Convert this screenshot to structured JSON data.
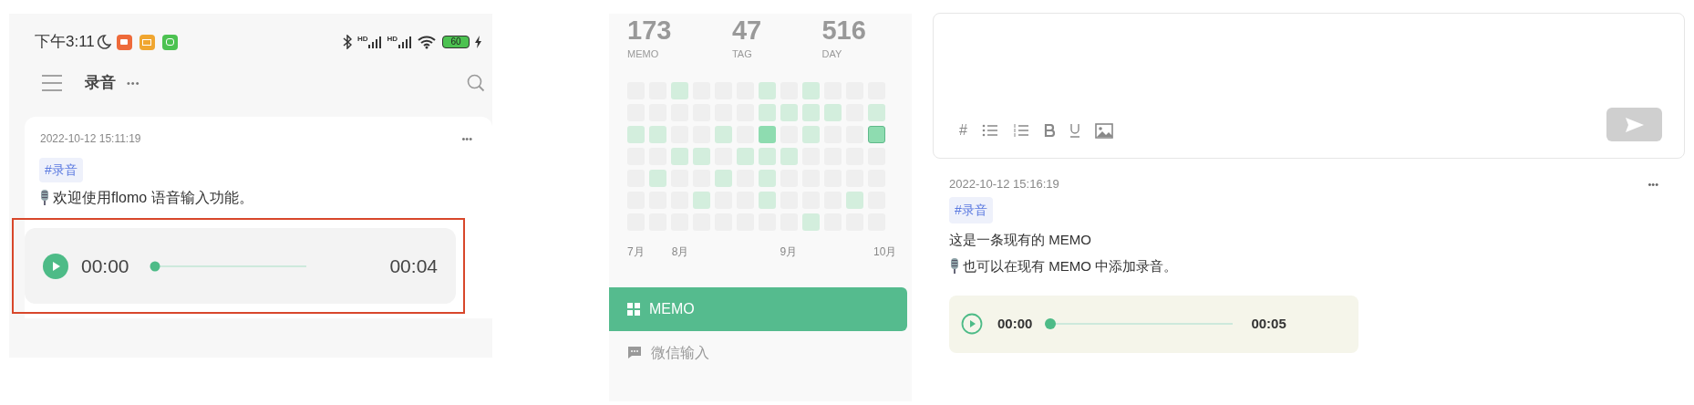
{
  "phone": {
    "status_bar": {
      "time": "下午3:11",
      "signals": [
        {
          "label": "HD"
        },
        {
          "label": "HD"
        }
      ],
      "battery": "60"
    },
    "header": {
      "title": "录音",
      "more": "•••"
    },
    "memo": {
      "date": "2022-10-12 15:11:19",
      "more": "•••",
      "tag": "#录音",
      "body": "欢迎使用flomo 语音输入功能。",
      "player": {
        "current": "00:00",
        "level": 0,
        "duration": "00:04"
      },
      "highlighted": true
    }
  },
  "sidebar": {
    "stats": [
      {
        "value": "173",
        "label": "MEMO"
      },
      {
        "value": "47",
        "label": "TAG"
      },
      {
        "value": "516",
        "label": "DAY"
      }
    ],
    "heatmap": {
      "rows": [
        {
          "cells": [
            {
              "color": "#efefef",
              "today": false
            },
            {
              "color": "#efefef",
              "today": false
            },
            {
              "color": "#d3eedd",
              "today": false
            },
            {
              "color": "#efefef",
              "today": false
            },
            {
              "color": "#efefef",
              "today": false
            },
            {
              "color": "#efefef",
              "today": false
            },
            {
              "color": "#d3eedd",
              "today": false
            },
            {
              "color": "#efefef",
              "today": false
            },
            {
              "color": "#d3eedd",
              "today": false
            },
            {
              "color": "#efefef",
              "today": false
            },
            {
              "color": "#efefef",
              "today": false
            },
            {
              "color": "#efefef",
              "today": false
            }
          ]
        },
        {
          "cells": [
            {
              "color": "#efefef",
              "today": false
            },
            {
              "color": "#efefef",
              "today": false
            },
            {
              "color": "#efefef",
              "today": false
            },
            {
              "color": "#efefef",
              "today": false
            },
            {
              "color": "#efefef",
              "today": false
            },
            {
              "color": "#efefef",
              "today": false
            },
            {
              "color": "#d3eedd",
              "today": false
            },
            {
              "color": "#d3eedd",
              "today": false
            },
            {
              "color": "#d3eedd",
              "today": false
            },
            {
              "color": "#d3eedd",
              "today": false
            },
            {
              "color": "#efefef",
              "today": false
            },
            {
              "color": "#d3eedd",
              "today": false
            }
          ]
        },
        {
          "cells": [
            {
              "color": "#d3eedd",
              "today": false
            },
            {
              "color": "#d3eedd",
              "today": false
            },
            {
              "color": "#efefef",
              "today": false
            },
            {
              "color": "#efefef",
              "today": false
            },
            {
              "color": "#d3eedd",
              "today": false
            },
            {
              "color": "#efefef",
              "today": false
            },
            {
              "color": "#8edcb0",
              "today": false
            },
            {
              "color": "#efefef",
              "today": false
            },
            {
              "color": "#d3eedd",
              "today": false
            },
            {
              "color": "#efefef",
              "today": false
            },
            {
              "color": "#efefef",
              "today": false
            },
            {
              "color": "#8edcb0",
              "today": true
            }
          ]
        },
        {
          "cells": [
            {
              "color": "#efefef",
              "today": false
            },
            {
              "color": "#efefef",
              "today": false
            },
            {
              "color": "#d3eedd",
              "today": false
            },
            {
              "color": "#d3eedd",
              "today": false
            },
            {
              "color": "#efefef",
              "today": false
            },
            {
              "color": "#d3eedd",
              "today": false
            },
            {
              "color": "#d3eedd",
              "today": false
            },
            {
              "color": "#d3eedd",
              "today": false
            },
            {
              "color": "#efefef",
              "today": false
            },
            {
              "color": "#efefef",
              "today": false
            },
            {
              "color": "#efefef",
              "today": false
            },
            {
              "color": "#efefef",
              "today": false
            }
          ]
        },
        {
          "cells": [
            {
              "color": "#efefef",
              "today": false
            },
            {
              "color": "#d3eedd",
              "today": false
            },
            {
              "color": "#efefef",
              "today": false
            },
            {
              "color": "#efefef",
              "today": false
            },
            {
              "color": "#d3eedd",
              "today": false
            },
            {
              "color": "#efefef",
              "today": false
            },
            {
              "color": "#d3eedd",
              "today": false
            },
            {
              "color": "#efefef",
              "today": false
            },
            {
              "color": "#efefef",
              "today": false
            },
            {
              "color": "#efefef",
              "today": false
            },
            {
              "color": "#efefef",
              "today": false
            },
            {
              "color": "#efefef",
              "today": false
            }
          ]
        },
        {
          "cells": [
            {
              "color": "#efefef",
              "today": false
            },
            {
              "color": "#efefef",
              "today": false
            },
            {
              "color": "#efefef",
              "today": false
            },
            {
              "color": "#d3eedd",
              "today": false
            },
            {
              "color": "#efefef",
              "today": false
            },
            {
              "color": "#efefef",
              "today": false
            },
            {
              "color": "#d3eedd",
              "today": false
            },
            {
              "color": "#efefef",
              "today": false
            },
            {
              "color": "#efefef",
              "today": false
            },
            {
              "color": "#efefef",
              "today": false
            },
            {
              "color": "#d3eedd",
              "today": false
            },
            {
              "color": "#efefef",
              "today": false
            }
          ]
        },
        {
          "cells": [
            {
              "color": "#efefef",
              "today": false
            },
            {
              "color": "#efefef",
              "today": false
            },
            {
              "color": "#efefef",
              "today": false
            },
            {
              "color": "#efefef",
              "today": false
            },
            {
              "color": "#efefef",
              "today": false
            },
            {
              "color": "#efefef",
              "today": false
            },
            {
              "color": "#efefef",
              "today": false
            },
            {
              "color": "#efefef",
              "today": false
            },
            {
              "color": "#d3eedd",
              "today": false
            },
            {
              "color": "#efefef",
              "today": false
            },
            {
              "color": "#efefef",
              "today": false
            },
            {
              "color": "#efefef",
              "today": false
            }
          ]
        }
      ],
      "months": [
        "7月",
        "8月",
        "9月",
        "10月"
      ]
    },
    "items": [
      {
        "kind": "grid",
        "label": "MEMO",
        "selected": true
      },
      {
        "kind": "chat",
        "label": "微信输入",
        "selected": false
      }
    ]
  },
  "editor": {
    "tools": [
      {
        "kind": "hash",
        "label": "#"
      },
      {
        "kind": "bullets"
      },
      {
        "kind": "numbers"
      },
      {
        "kind": "bold"
      },
      {
        "kind": "underline"
      },
      {
        "kind": "image"
      }
    ],
    "send_disabled": true
  },
  "memo": {
    "date": "2022-10-12 15:16:19",
    "more": "•••",
    "tag": "#录音",
    "lines": [
      "这是一条现有的 MEMO",
      "也可以在现有 MEMO 中添加录音。"
    ],
    "player": {
      "current": "00:00",
      "level": 0,
      "duration": "00:05"
    }
  }
}
